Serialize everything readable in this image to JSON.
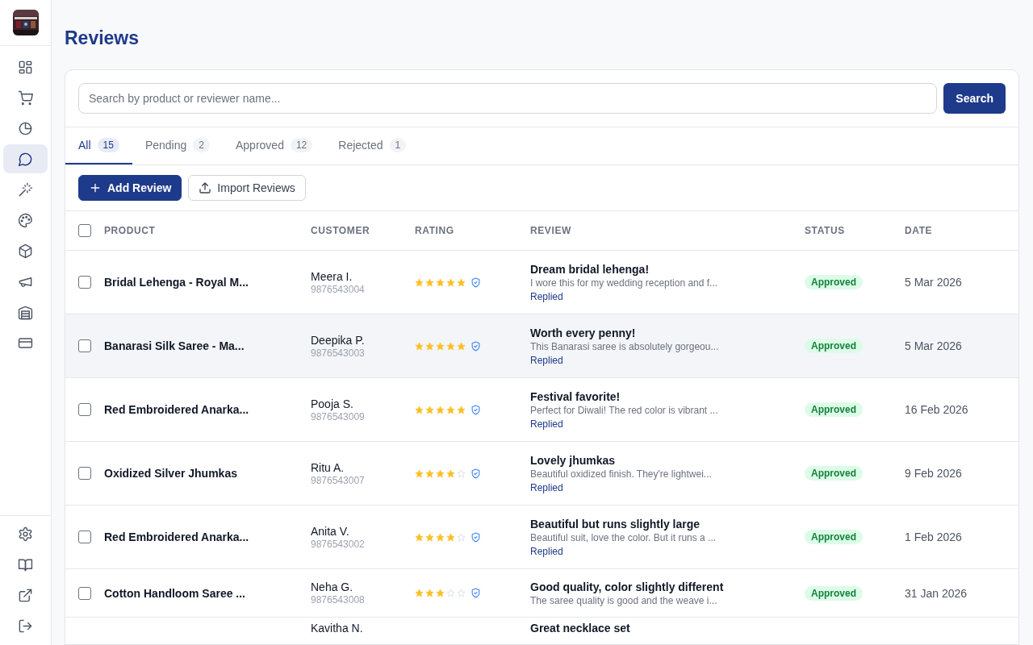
{
  "sidebar": {
    "items": [
      {
        "kind": "grid",
        "selected": false
      },
      {
        "kind": "cart",
        "selected": false
      },
      {
        "kind": "pie",
        "selected": false
      },
      {
        "kind": "chat",
        "selected": true
      },
      {
        "kind": "wand",
        "selected": false
      },
      {
        "kind": "palette",
        "selected": false
      },
      {
        "kind": "box",
        "selected": false
      },
      {
        "kind": "megaphone",
        "selected": false
      },
      {
        "kind": "warehouse",
        "selected": false
      },
      {
        "kind": "card",
        "selected": false
      }
    ],
    "bottom_items": [
      {
        "kind": "gear"
      },
      {
        "kind": "book"
      },
      {
        "kind": "external"
      },
      {
        "kind": "logout"
      }
    ]
  },
  "page_title": "Reviews",
  "search": {
    "placeholder": "Search by product or reviewer name...",
    "button": "Search"
  },
  "tabs": [
    {
      "label": "All",
      "count": "15",
      "selected": true
    },
    {
      "label": "Pending",
      "count": "2",
      "selected": false
    },
    {
      "label": "Approved",
      "count": "12",
      "selected": false
    },
    {
      "label": "Rejected",
      "count": "1",
      "selected": false
    }
  ],
  "actions": [
    {
      "kind": "primary",
      "label": "Add Review"
    },
    {
      "kind": "secondary",
      "label": "Import Reviews"
    }
  ],
  "table": {
    "select_all": {
      "checked": false
    },
    "columns": [
      "PRODUCT",
      "CUSTOMER",
      "RATING",
      "REVIEW",
      "STATUS",
      "DATE"
    ],
    "rows": [
      {
        "checked": false,
        "hovered": false,
        "product": "Bridal Lehenga - Royal M...",
        "customer": "Meera I.",
        "phone": "9876543004",
        "stars": 5,
        "title": "Dream bridal lehenga!",
        "excerpt": "I wore this for my wedding reception and f...",
        "reply": "Replied",
        "status": "Approved",
        "date": "5 Mar 2026"
      },
      {
        "checked": false,
        "hovered": true,
        "product": "Banarasi Silk Saree - Ma...",
        "customer": "Deepika P.",
        "phone": "9876543003",
        "stars": 5,
        "title": "Worth every penny!",
        "excerpt": "This Banarasi saree is absolutely gorgeou...",
        "reply": "Replied",
        "status": "Approved",
        "date": "5 Mar 2026"
      },
      {
        "checked": false,
        "hovered": false,
        "product": "Red Embroidered Anarka...",
        "customer": "Pooja S.",
        "phone": "9876543009",
        "stars": 5,
        "title": "Festival favorite!",
        "excerpt": "Perfect for Diwali! The red color is vibrant ...",
        "reply": "Replied",
        "status": "Approved",
        "date": "16 Feb 2026"
      },
      {
        "checked": false,
        "hovered": false,
        "product": "Oxidized Silver Jhumkas",
        "customer": "Ritu A.",
        "phone": "9876543007",
        "stars": 4,
        "title": "Lovely jhumkas",
        "excerpt": "Beautiful oxidized finish. They're lightwei...",
        "reply": "Replied",
        "status": "Approved",
        "date": "9 Feb 2026"
      },
      {
        "checked": false,
        "hovered": false,
        "product": "Red Embroidered Anarka...",
        "customer": "Anita V.",
        "phone": "9876543002",
        "stars": 4,
        "title": "Beautiful but runs slightly large",
        "excerpt": "Beautiful suit, love the color. But it runs a ...",
        "reply": "Replied",
        "status": "Approved",
        "date": "1 Feb 2026"
      },
      {
        "checked": false,
        "hovered": false,
        "product": "Cotton Handloom Saree ...",
        "customer": "Neha G.",
        "phone": "9876543008",
        "stars": 3,
        "title": "Good quality, color slightly different",
        "excerpt": "The saree quality is good and the weave i...",
        "status": "Approved",
        "date": "31 Jan 2026"
      },
      {
        "customer": "Kavitha N.",
        "title": "Great necklace set"
      }
    ]
  }
}
